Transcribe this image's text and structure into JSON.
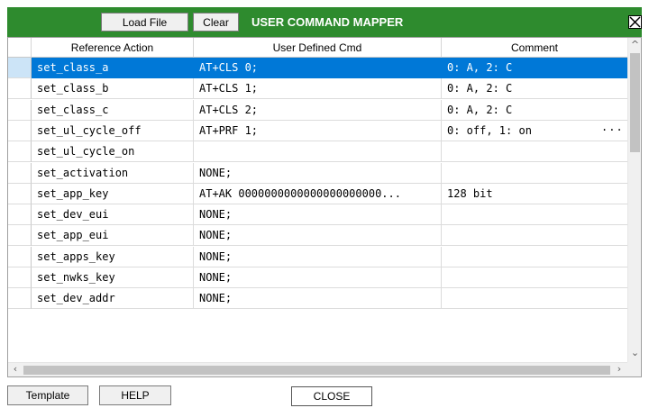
{
  "toolbar": {
    "load_file": "Load File",
    "clear": "Clear",
    "title": "USER COMMAND MAPPER",
    "close_icon": "close-x-icon"
  },
  "grid": {
    "columns": [
      "Reference Action",
      "User Defined Cmd",
      "Comment"
    ],
    "selected_row": 0,
    "rows": [
      {
        "action": "set_class_a",
        "cmd": "AT+CLS 0;",
        "comment": "0: A, 2: C"
      },
      {
        "action": "set_class_b",
        "cmd": "AT+CLS 1;",
        "comment": "0: A, 2: C"
      },
      {
        "action": "set_class_c",
        "cmd": "AT+CLS 2;",
        "comment": "0: A, 2: C"
      },
      {
        "action": "set_ul_cycle_off",
        "cmd": "AT+PRF 1;",
        "comment": "0: off, 1: on",
        "comment_more": "..."
      },
      {
        "action": "set_ul_cycle_on",
        "cmd": "",
        "comment": ""
      },
      {
        "action": "set_activation",
        "cmd": "NONE;",
        "comment": ""
      },
      {
        "action": "set_app_key",
        "cmd": "AT+AK 0000000000000000000000...",
        "comment": "128 bit"
      },
      {
        "action": "set_dev_eui",
        "cmd": "NONE;",
        "comment": ""
      },
      {
        "action": "set_app_eui",
        "cmd": "NONE;",
        "comment": ""
      },
      {
        "action": "set_apps_key",
        "cmd": "NONE;",
        "comment": ""
      },
      {
        "action": "set_nwks_key",
        "cmd": "NONE;",
        "comment": ""
      },
      {
        "action": "set_dev_addr",
        "cmd": "NONE;",
        "comment": ""
      }
    ]
  },
  "footer": {
    "template": "Template",
    "help": "HELP",
    "close": "CLOSE"
  },
  "colors": {
    "titlebar": "#2e8b2e",
    "selection": "#0078d7"
  }
}
